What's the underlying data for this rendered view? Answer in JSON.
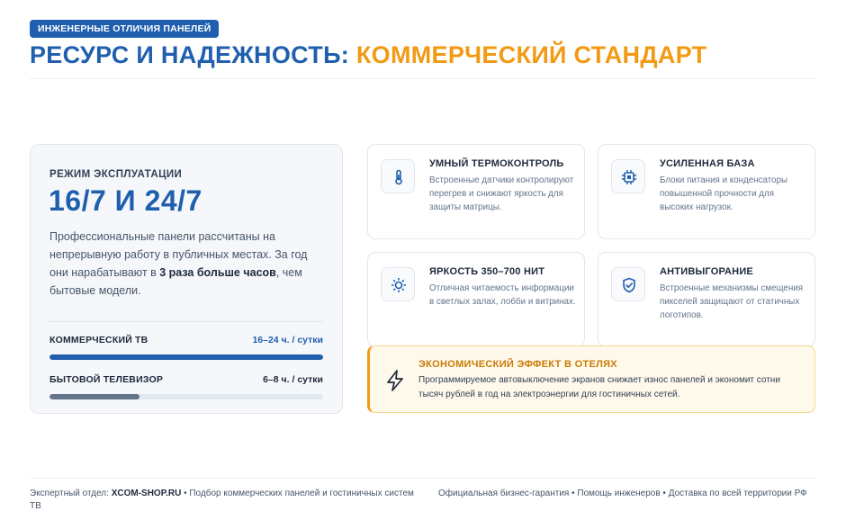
{
  "header": {
    "badge": "ИНЖЕНЕРНЫЕ ОТЛИЧИЯ ПАНЕЛЕЙ",
    "title_part1": "РЕСУРС И НАДЕЖНОСТЬ:",
    "title_part2": "КОММЕРЧЕСКИЙ СТАНДАРТ"
  },
  "mode": {
    "label": "РЕЖИМ ЭКСПЛУАТАЦИИ",
    "value": "16/7 И 24/7",
    "desc_before": "Профессиональные панели рассчитаны на непрерывную работу в публичных местах. За год они нарабатывают в ",
    "desc_bold": "3 раза больше часов",
    "desc_after": ", чем бытовые модели.",
    "bars": [
      {
        "name": "КОММЕРЧЕСКИЙ ТВ",
        "value": "16–24 ч. / сутки",
        "fill": 1.0
      },
      {
        "name": "БЫТОВОЙ ТЕЛЕВИЗОР",
        "value": "6–8 ч. / сутки",
        "fill": 0.33
      }
    ]
  },
  "features": [
    {
      "title": "УМНЫЙ ТЕРМОКОНТРОЛЬ",
      "desc": "Встроенные датчики контролируют перегрев и снижают яркость для защиты матрицы.",
      "icon": "thermometer-icon"
    },
    {
      "title": "УСИЛЕННАЯ БАЗА",
      "desc": "Блоки питания и конденсаторы повышенной прочности для высоких нагрузок.",
      "icon": "cpu-icon"
    },
    {
      "title": "ЯРКОСТЬ 350–700 НИТ",
      "desc": "Отличная читаемость информации в светлых залах, лобби и витринах.",
      "icon": "sun-icon"
    },
    {
      "title": "АНТИВЫГОРАНИЕ",
      "desc": "Встроенные механизмы смещения пикселей защищают от статичных логотипов.",
      "icon": "shield-check-icon"
    }
  ],
  "eco": {
    "title": "ЭКОНОМИЧЕСКИЙ ЭФФЕКТ В ОТЕЛЯХ",
    "desc": "Программируемое автовыключение экранов снижает износ панелей и экономит сотни тысяч рублей в год на электроэнергии для гостиничных сетей.",
    "icon": "lightning-icon"
  },
  "footer": {
    "left_prefix": "Экспертный отдел: ",
    "left_site": "XCOM-SHOP.RU",
    "left_rest": " • Подбор коммерческих панелей и гостиничных систем ТВ",
    "right": "Официальная бизнес-гарантия • Помощь инженеров • Доставка по всей территории РФ"
  },
  "colors": {
    "brand_blue": "#1f5fae",
    "accent_orange": "#f29a13",
    "gray_bar": "#64748b"
  }
}
